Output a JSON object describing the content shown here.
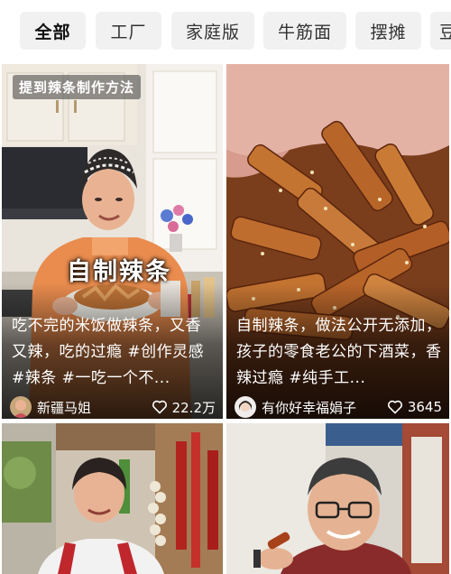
{
  "tabs": [
    {
      "label": "全部",
      "active": true
    },
    {
      "label": "工厂",
      "active": false
    },
    {
      "label": "家庭版",
      "active": false
    },
    {
      "label": "牛筋面",
      "active": false
    },
    {
      "label": "摆摊",
      "active": false
    },
    {
      "label": "豆",
      "active": false
    }
  ],
  "cards": [
    {
      "tag": "提到辣条制作方法",
      "overlay_title": "自制辣条",
      "caption": "吃不完的米饭做辣条，又香又辣，吃的过瘾 #创作灵感 #辣条 #一吃一个不...",
      "author": "新疆马姐",
      "likes": "22.2万"
    },
    {
      "caption": "自制辣条，做法公开无添加，孩子的零食老公的下酒菜，香辣过瘾 #纯手工...",
      "author": "有你好幸福娟子",
      "likes": "3645"
    }
  ]
}
